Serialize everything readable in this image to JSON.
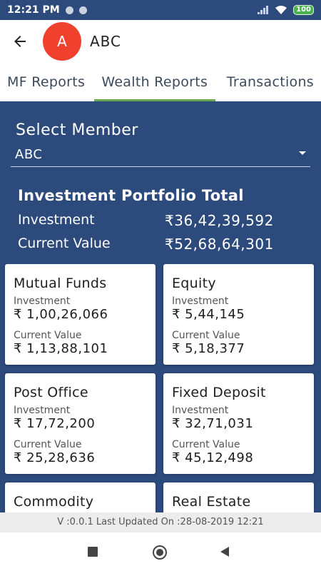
{
  "status_bar": {
    "time": "12:21 PM",
    "battery": "100"
  },
  "header": {
    "avatar_letter": "A",
    "title": "ABC"
  },
  "tabs": [
    {
      "label": "MF Reports"
    },
    {
      "label": "Wealth Reports"
    },
    {
      "label": "Transactions"
    }
  ],
  "member": {
    "label": "Select Member",
    "value": "ABC"
  },
  "portfolio": {
    "title": "Investment Portfolio Total",
    "investment_label": "Investment",
    "investment_value": "₹36,42,39,592",
    "current_label": "Current Value",
    "current_value": "₹52,68,64,301"
  },
  "cards": [
    {
      "title": "Mutual Funds",
      "inv_label": "Investment",
      "inv_value": "₹ 1,00,26,066",
      "cur_label": "Current Value",
      "cur_value": "₹ 1,13,88,101"
    },
    {
      "title": "Equity",
      "inv_label": "Investment",
      "inv_value": "₹ 5,44,145",
      "cur_label": "Current Value",
      "cur_value": "₹ 5,18,377"
    },
    {
      "title": "Post Office",
      "inv_label": "Investment",
      "inv_value": "₹ 17,72,200",
      "cur_label": "Current Value",
      "cur_value": "₹ 25,28,636"
    },
    {
      "title": "Fixed Deposit",
      "inv_label": "Investment",
      "inv_value": "₹ 32,71,031",
      "cur_label": "Current Value",
      "cur_value": "₹ 45,12,498"
    },
    {
      "title": "Commodity"
    },
    {
      "title": "Real Estate"
    }
  ],
  "footer": {
    "version_text": "V :0.0.1 Last Updated On :28-08-2019 12:21"
  },
  "colors": {
    "primary": "#2d4a7d",
    "avatar": "#f0412f",
    "tab_indicator": "#6aa84f",
    "battery": "#4caf50"
  },
  "icons": [
    "back-arrow-icon",
    "dropdown-arrow-icon",
    "signal-icon",
    "wifi-icon",
    "battery-icon",
    "nav-recents-icon",
    "nav-home-icon",
    "nav-back-icon"
  ]
}
